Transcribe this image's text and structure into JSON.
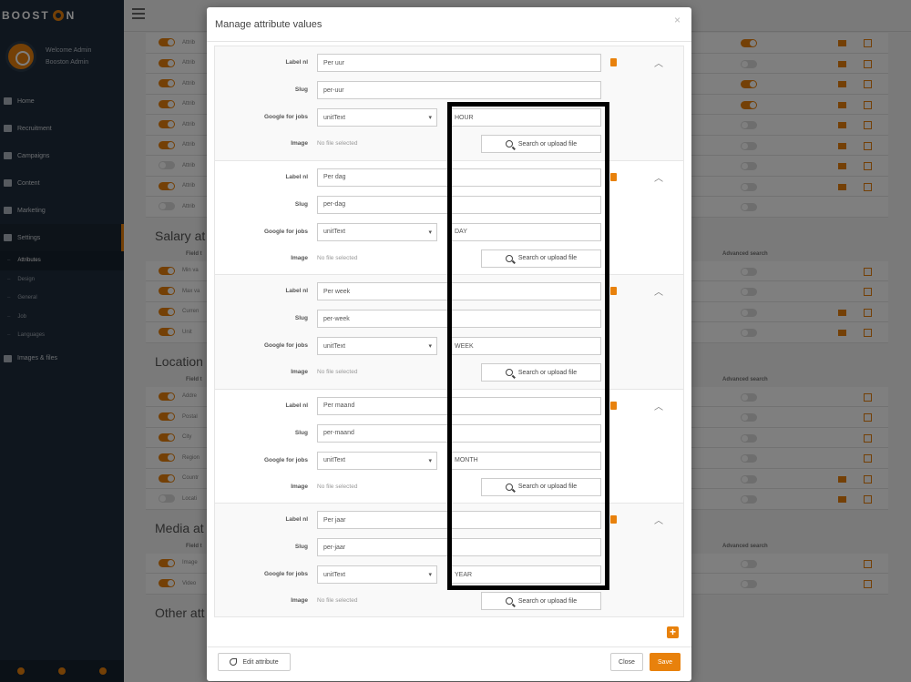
{
  "sidebar": {
    "logo": {
      "prefix": "BOOST",
      "suffix": "N"
    },
    "user": {
      "welcome": "Welcome Admin",
      "name": "Booston Admin"
    },
    "nav": [
      {
        "label": "Home",
        "icon": "home-icon"
      },
      {
        "label": "Recruitment",
        "icon": "users-icon"
      },
      {
        "label": "Campaigns",
        "icon": "chart-icon"
      },
      {
        "label": "Content",
        "icon": "file-icon"
      },
      {
        "label": "Marketing",
        "icon": "line-chart-icon"
      },
      {
        "label": "Settings",
        "icon": "gear-icon"
      }
    ],
    "settings_sub": [
      "Attributes",
      "Design",
      "General",
      "Job",
      "Languages"
    ],
    "images_files": "Images & files"
  },
  "background": {
    "rows_top": [
      "Attrib",
      "Attrib",
      "Attrib",
      "Attrib",
      "Attrib",
      "Attrib",
      "Attrib",
      "Attrib",
      "Attrib"
    ],
    "salary_title": "Salary at",
    "salary_head": "Field t",
    "salary_rows": [
      "Min va",
      "Max va",
      "Curren",
      "Unit"
    ],
    "location_title": "Location",
    "location_head": "Field t",
    "location_rows": [
      "Addre",
      "Postal",
      "City",
      "Region",
      "Countr",
      "Locati"
    ],
    "media_title": "Media at",
    "media_head": "Field t",
    "media_rows": [
      "Image",
      "Video"
    ],
    "other_title": "Other att",
    "advanced_search": "Advanced search"
  },
  "modal": {
    "title": "Manage attribute values",
    "close_glyph": "×",
    "labels": {
      "label_nl": "Label nl",
      "slug": "Slug",
      "google": "Google for jobs",
      "image": "Image"
    },
    "no_file": "No file selected",
    "upload": "Search or upload file",
    "values": [
      {
        "label": "Per uur",
        "slug": "per-uur",
        "google_type": "unitText",
        "google_value": "HOUR"
      },
      {
        "label": "Per dag",
        "slug": "per-dag",
        "google_type": "unitText",
        "google_value": "DAY"
      },
      {
        "label": "Per week",
        "slug": "per-week",
        "google_type": "unitText",
        "google_value": "WEEK"
      },
      {
        "label": "Per maand",
        "slug": "per-maand",
        "google_type": "unitText",
        "google_value": "MONTH"
      },
      {
        "label": "Per jaar",
        "slug": "per-jaar",
        "google_type": "unitText",
        "google_value": "YEAR"
      }
    ],
    "add_glyph": "+",
    "edit_attribute": "Edit attribute",
    "close_button": "Close",
    "save_button": "Save"
  },
  "colors": {
    "accent": "#e8810c",
    "sidebar": "#1f2d3d"
  }
}
